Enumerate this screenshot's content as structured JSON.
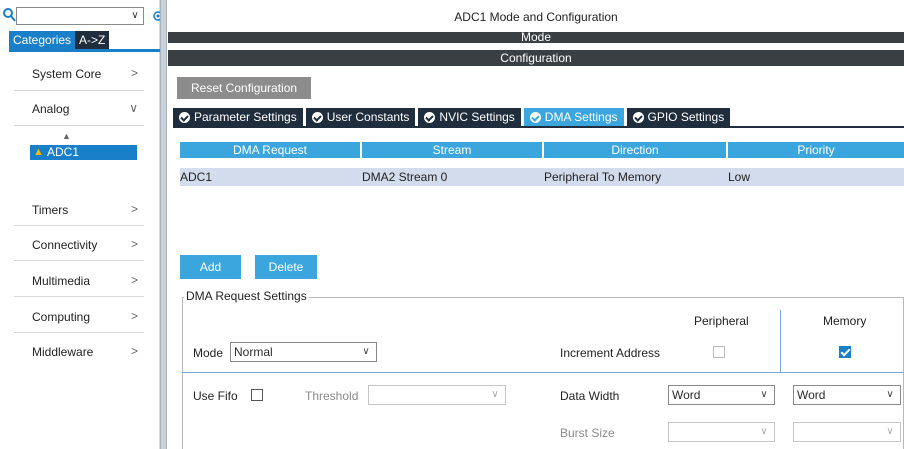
{
  "sidebar": {
    "search": {
      "value": "",
      "caret": "∨"
    },
    "view_tabs": [
      "Categories",
      "A->Z"
    ],
    "categories": [
      {
        "label": "System Core",
        "chevron": ">"
      },
      {
        "label": "Analog",
        "chevron": "∨"
      },
      {
        "label": "Timers",
        "chevron": ">"
      },
      {
        "label": "Connectivity",
        "chevron": ">"
      },
      {
        "label": "Multimedia",
        "chevron": ">"
      },
      {
        "label": "Computing",
        "chevron": ">"
      },
      {
        "label": "Middleware",
        "chevron": ">"
      }
    ],
    "analog_items": [
      {
        "label": "ADC1",
        "warning": true
      }
    ]
  },
  "main": {
    "title": "ADC1 Mode and Configuration",
    "mode_bar": "Mode",
    "config_bar": "Configuration",
    "reset_label": "Reset Configuration",
    "tabs": [
      {
        "label": "Parameter Settings",
        "active": false
      },
      {
        "label": "User Constants",
        "active": false
      },
      {
        "label": "NVIC Settings",
        "active": false
      },
      {
        "label": "DMA Settings",
        "active": true
      },
      {
        "label": "GPIO Settings",
        "active": false
      }
    ],
    "dma_table": {
      "headers": [
        "DMA Request",
        "Stream",
        "Direction",
        "Priority"
      ],
      "rows": [
        [
          "ADC1",
          "DMA2 Stream 0",
          "Peripheral To Memory",
          "Low"
        ]
      ]
    },
    "add_label": "Add",
    "delete_label": "Delete",
    "settings": {
      "title": "DMA Request Settings",
      "col_peripheral": "Peripheral",
      "col_memory": "Memory",
      "mode_label": "Mode",
      "mode_value": "Normal",
      "increment_label": "Increment Address",
      "peripheral_increment": false,
      "memory_increment": true,
      "use_fifo_label": "Use Fifo",
      "use_fifo": false,
      "threshold_label": "Threshold",
      "threshold_value": "",
      "data_width_label": "Data Width",
      "peripheral_data_width": "Word",
      "memory_data_width": "Word",
      "burst_size_label": "Burst Size",
      "peripheral_burst": "",
      "memory_burst": ""
    }
  }
}
